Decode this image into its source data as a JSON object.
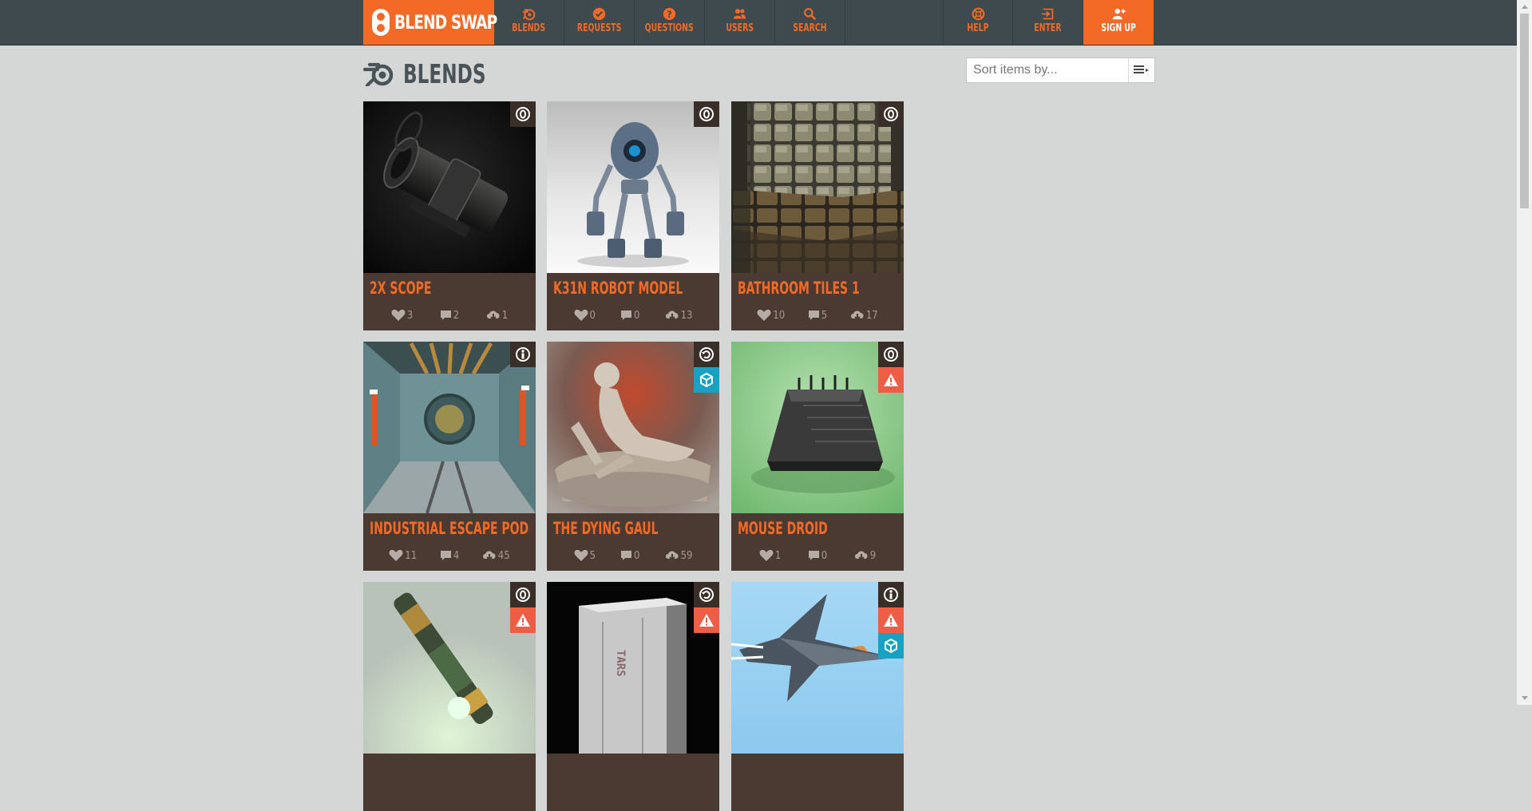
{
  "brand": {
    "name": "BLEND SWAP",
    "accent": "#f26a25",
    "bar": "#3f4a4e",
    "card": "#4a3a32"
  },
  "nav_left": [
    {
      "label": "BLENDS",
      "icon": "blender-icon"
    },
    {
      "label": "REQUESTS",
      "icon": "check-circle-icon"
    },
    {
      "label": "QUESTIONS",
      "icon": "question-circle-icon"
    },
    {
      "label": "USERS",
      "icon": "users-icon"
    },
    {
      "label": "SEARCH",
      "icon": "search-icon"
    }
  ],
  "nav_right": [
    {
      "label": "HELP",
      "icon": "lifebuoy-icon"
    },
    {
      "label": "ENTER",
      "icon": "sign-in-icon"
    },
    {
      "label": "SIGN UP",
      "icon": "user-plus-icon"
    }
  ],
  "page": {
    "title": "BLENDS",
    "sort_placeholder": "Sort items by..."
  },
  "cards": [
    {
      "title": "2X SCOPE",
      "likes": "3",
      "comments": "2",
      "downloads": "1",
      "badges": [
        "cc0-license-icon"
      ]
    },
    {
      "title": "K31N ROBOT MODEL",
      "likes": "0",
      "comments": "0",
      "downloads": "13",
      "badges": [
        "cc0-license-icon"
      ]
    },
    {
      "title": "BATHROOM TILES 1",
      "likes": "10",
      "comments": "5",
      "downloads": "17",
      "badges": [
        "cc0-license-icon"
      ]
    },
    {
      "title": "INDUSTRIAL ESCAPE POD",
      "likes": "11",
      "comments": "4",
      "downloads": "45",
      "badges": [
        "cc-by-license-icon"
      ]
    },
    {
      "title": "THE DYING GAUL",
      "likes": "5",
      "comments": "0",
      "downloads": "59",
      "badges": [
        "cc-by-sa-license-icon",
        "cube-icon"
      ]
    },
    {
      "title": "MOUSE DROID",
      "likes": "1",
      "comments": "0",
      "downloads": "9",
      "badges": [
        "cc0-license-icon",
        "warning-icon"
      ]
    },
    {
      "title": "",
      "likes": "",
      "comments": "",
      "downloads": "",
      "badges": [
        "cc0-license-icon",
        "warning-icon"
      ]
    },
    {
      "title": "",
      "likes": "",
      "comments": "",
      "downloads": "",
      "badges": [
        "cc-by-sa-license-icon",
        "warning-icon"
      ]
    },
    {
      "title": "",
      "likes": "",
      "comments": "",
      "downloads": "",
      "badges": [
        "cc-by-license-icon",
        "warning-icon",
        "cube-icon"
      ]
    }
  ],
  "thumb_text": {
    "monolith": "TARS"
  }
}
